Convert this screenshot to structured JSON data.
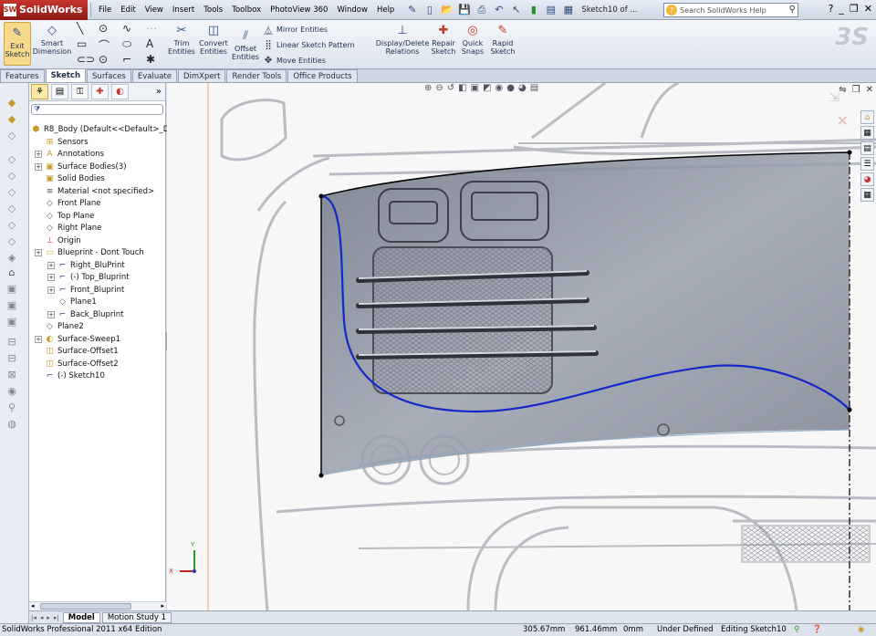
{
  "app": {
    "logo_text": "SolidWorks",
    "logo_mark": "SW",
    "menus": [
      "File",
      "Edit",
      "View",
      "Insert",
      "Tools",
      "Toolbox",
      "PhotoView 360",
      "Window",
      "Help"
    ],
    "document_title": "Sketch10 of ...",
    "search_placeholder": "Search SolidWorks Help",
    "help_icon": "?"
  },
  "command_manager": {
    "exit_sketch": "Exit\nSketch",
    "smart_dimension": "Smart\nDimension",
    "trim_entities": "Trim\nEntities",
    "convert_entities": "Convert\nEntities",
    "offset_entities": "Offset\nEntities",
    "mirror_entities": "Mirror Entities",
    "linear_sketch_pattern": "Linear Sketch Pattern",
    "move_entities": "Move Entities",
    "display_delete_relations": "Display/Delete\nRelations",
    "repair_sketch": "Repair\nSketch",
    "quick_snaps": "Quick\nSnaps",
    "rapid_sketch": "Rapid\nSketch"
  },
  "tabs": [
    {
      "label": "Features",
      "active": false
    },
    {
      "label": "Sketch",
      "active": true
    },
    {
      "label": "Surfaces",
      "active": false
    },
    {
      "label": "Evaluate",
      "active": false
    },
    {
      "label": "DimXpert",
      "active": false
    },
    {
      "label": "Render Tools",
      "active": false
    },
    {
      "label": "Office Products",
      "active": false
    }
  ],
  "feature_tree": {
    "root": "R8_Body  (Default<<Default>_Dis",
    "items": [
      {
        "label": "Sensors",
        "icon": "sensor-icon",
        "level": 1,
        "expand": false
      },
      {
        "label": "Annotations",
        "icon": "annotation-icon",
        "level": 1,
        "expand": true
      },
      {
        "label": "Surface Bodies(3)",
        "icon": "surface-bodies-icon",
        "level": 1,
        "expand": true
      },
      {
        "label": "Solid Bodies",
        "icon": "solid-bodies-icon",
        "level": 1,
        "expand": false
      },
      {
        "label": "Material <not specified>",
        "icon": "material-icon",
        "level": 1,
        "expand": false
      },
      {
        "label": "Front Plane",
        "icon": "plane-icon",
        "level": 1,
        "expand": false
      },
      {
        "label": "Top Plane",
        "icon": "plane-icon",
        "level": 1,
        "expand": false
      },
      {
        "label": "Right Plane",
        "icon": "plane-icon",
        "level": 1,
        "expand": false
      },
      {
        "label": "Origin",
        "icon": "origin-icon",
        "level": 1,
        "expand": false
      },
      {
        "label": "Blueprint - Dont Touch",
        "icon": "folder-icon",
        "level": 1,
        "expand": true
      },
      {
        "label": "Right_BluPrint",
        "icon": "sketch-icon",
        "level": 2,
        "expand": true
      },
      {
        "label": "(-) Top_Bluprint",
        "icon": "sketch-icon",
        "level": 2,
        "expand": true
      },
      {
        "label": "Front_Bluprint",
        "icon": "sketch-icon",
        "level": 2,
        "expand": true
      },
      {
        "label": "Plane1",
        "icon": "plane-icon",
        "level": 2,
        "expand": false
      },
      {
        "label": "Back_Bluprint",
        "icon": "sketch-icon",
        "level": 2,
        "expand": true
      },
      {
        "label": "Plane2",
        "icon": "plane-icon",
        "level": 1,
        "expand": false
      },
      {
        "label": "Surface-Sweep1",
        "icon": "surface-sweep-icon",
        "level": 1,
        "expand": true
      },
      {
        "label": "Surface-Offset1",
        "icon": "surface-offset-icon",
        "level": 1,
        "expand": false
      },
      {
        "label": "Surface-Offset2",
        "icon": "surface-offset-icon",
        "level": 1,
        "expand": false
      },
      {
        "label": "(-) Sketch10",
        "icon": "sketch-icon",
        "level": 1,
        "expand": false
      }
    ]
  },
  "model_tabs": [
    {
      "label": "Model",
      "active": true
    },
    {
      "label": "Motion Study 1",
      "active": false
    }
  ],
  "status": {
    "product": "SolidWorks Professional 2011 x64 Edition",
    "x": "305.67mm",
    "y": "961.46mm",
    "z": "0mm",
    "definition": "Under Defined",
    "editing": "Editing Sketch10"
  },
  "triad": {
    "x_label": "X",
    "y_label": "Y"
  },
  "colors": {
    "sketch_curve": "#1428c8",
    "surface_fill": "#5a6272",
    "accent_red": "#b0241d"
  }
}
